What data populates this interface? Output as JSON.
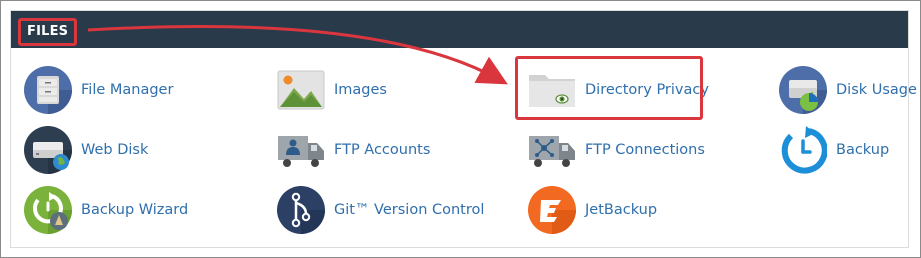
{
  "section": {
    "title": "FILES"
  },
  "items": [
    {
      "label": "File Manager",
      "icon": "file-manager-icon"
    },
    {
      "label": "Images",
      "icon": "images-icon"
    },
    {
      "label": "Directory Privacy",
      "icon": "directory-privacy-icon"
    },
    {
      "label": "Disk Usage",
      "icon": "disk-usage-icon"
    },
    {
      "label": "Web Disk",
      "icon": "web-disk-icon"
    },
    {
      "label": "FTP Accounts",
      "icon": "ftp-accounts-icon"
    },
    {
      "label": "FTP Connections",
      "icon": "ftp-connections-icon"
    },
    {
      "label": "Backup",
      "icon": "backup-icon"
    },
    {
      "label": "Backup Wizard",
      "icon": "backup-wizard-icon"
    },
    {
      "label": "Git™ Version Control",
      "icon": "git-icon"
    },
    {
      "label": "JetBackup",
      "icon": "jetbackup-icon"
    }
  ],
  "colors": {
    "header": "#293a4a",
    "link": "#2f6fad",
    "annotation": "#d9363e"
  }
}
